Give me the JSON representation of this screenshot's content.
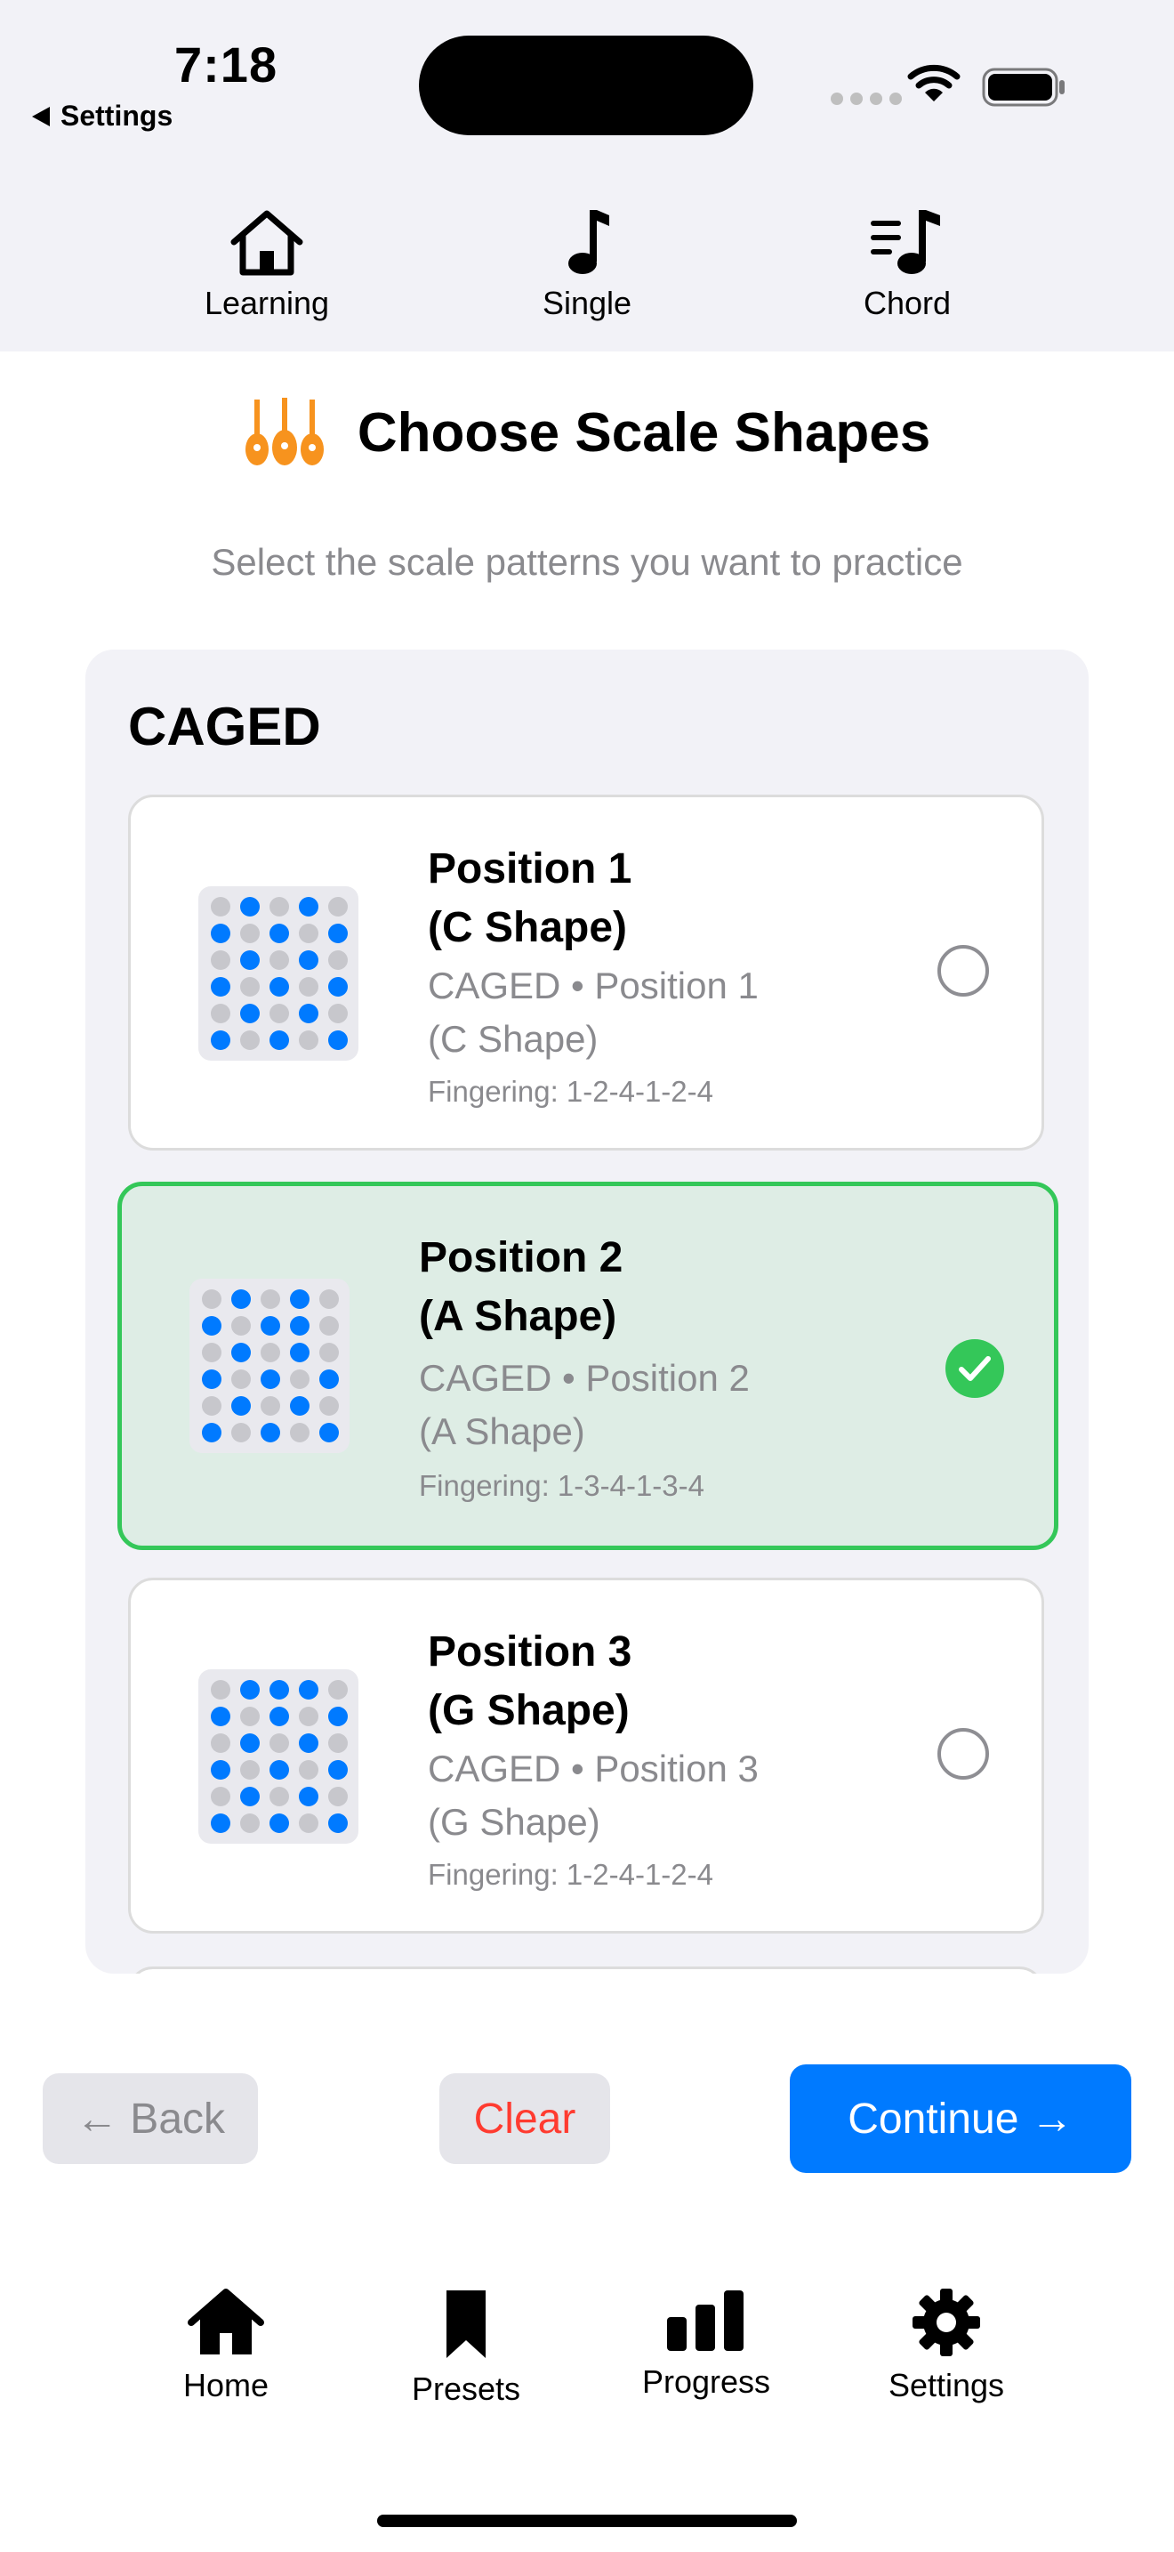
{
  "status_bar": {
    "time": "7:18",
    "back_label": "Settings"
  },
  "top_tabs": [
    {
      "label": "Learning",
      "icon": "house-icon"
    },
    {
      "label": "Single",
      "icon": "music-note-icon"
    },
    {
      "label": "Chord",
      "icon": "music-list-icon"
    }
  ],
  "header": {
    "title": "Choose Scale Shapes",
    "subtitle": "Select the scale patterns you want to practice",
    "icon": "guitars-icon"
  },
  "group": {
    "title": "CAGED"
  },
  "cards": [
    {
      "name": "Position 1\n(C Shape)",
      "description": "CAGED • Position 1\n(C Shape)",
      "fingering": "Fingering: 1-2-4-1-2-4",
      "selected": false
    },
    {
      "name": "Position 2\n(A Shape)",
      "description": "CAGED • Position 2\n(A Shape)",
      "fingering": "Fingering: 1-3-4-1-3-4",
      "selected": true
    },
    {
      "name": "Position 3\n(G Shape)",
      "description": "CAGED • Position 3\n(G Shape)",
      "fingering": "Fingering: 1-2-4-1-2-4",
      "selected": false
    }
  ],
  "actions": {
    "back": "← Back",
    "clear": "Clear",
    "continue": "Continue →"
  },
  "bottom_tabs": [
    {
      "label": "Home",
      "icon": "house-fill-icon"
    },
    {
      "label": "Presets",
      "icon": "bookmark-icon"
    },
    {
      "label": "Progress",
      "icon": "bar-chart-icon"
    },
    {
      "label": "Settings",
      "icon": "gear-icon"
    }
  ],
  "colors": {
    "accent": "#007aff",
    "selected_border": "#34c759",
    "selected_bg": "#deede5",
    "clear_text": "#ff3b30",
    "guitar_icon": "#f7931e"
  }
}
